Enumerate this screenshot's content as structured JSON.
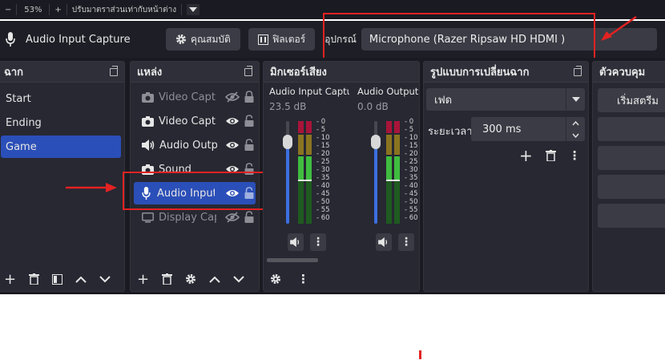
{
  "top_strip": {
    "minus": "−",
    "zoom": "53%",
    "plus": "+",
    "fit_label": "ปรับมาตราส่วนเท่ากับหน้าต่าง"
  },
  "toolbar": {
    "source_name": "Audio Input Capture",
    "properties_label": "คุณสมบัติ",
    "filters_label": "ฟิลเตอร์",
    "device_label": "อุปกรณ์",
    "device_value": "Microphone (Razer Ripsaw HD HDMI )"
  },
  "scenes": {
    "title": "ฉาก",
    "items": [
      {
        "label": "Start",
        "selected": false
      },
      {
        "label": "Ending",
        "selected": false
      },
      {
        "label": "Game",
        "selected": true
      }
    ]
  },
  "sources": {
    "title": "แหล่ง",
    "items": [
      {
        "label": "Video Capture Device",
        "icon": "camera-icon",
        "visible": false
      },
      {
        "label": "Video Capture Device",
        "icon": "camera-icon",
        "visible": true
      },
      {
        "label": "Audio Output Capture",
        "icon": "speaker-icon",
        "visible": true
      },
      {
        "label": "Sound",
        "icon": "camera-icon",
        "visible": true
      },
      {
        "label": "Audio Input Capture",
        "icon": "microphone-icon",
        "visible": true,
        "selected": true
      },
      {
        "label": "Display Capture",
        "icon": "monitor-icon",
        "visible": false
      }
    ]
  },
  "mixer": {
    "title": "มิกเซอร์เสียง",
    "channels": [
      {
        "name": "Audio Input Capture",
        "db": "23.5 dB",
        "volume_fraction": 0.8
      },
      {
        "name": "Audio Output Capture",
        "db": "0.0 dB",
        "volume_fraction": 0.8
      }
    ],
    "scale": [
      "0",
      "-5",
      "-10",
      "-15",
      "-20",
      "-25",
      "-30",
      "-35",
      "-40",
      "-45",
      "-50",
      "-55",
      "-60"
    ]
  },
  "transitions": {
    "title": "รูปแบบการเปลี่ยนฉาก",
    "selected": "เฟด",
    "duration_label": "ระยะเวลา",
    "duration_value": "300 ms"
  },
  "controls": {
    "title": "ตัวควบคุม",
    "start_label": "เริ่มสตรีม"
  },
  "colors": {
    "accent": "#2b4fb8",
    "highlight": "#e32222"
  }
}
